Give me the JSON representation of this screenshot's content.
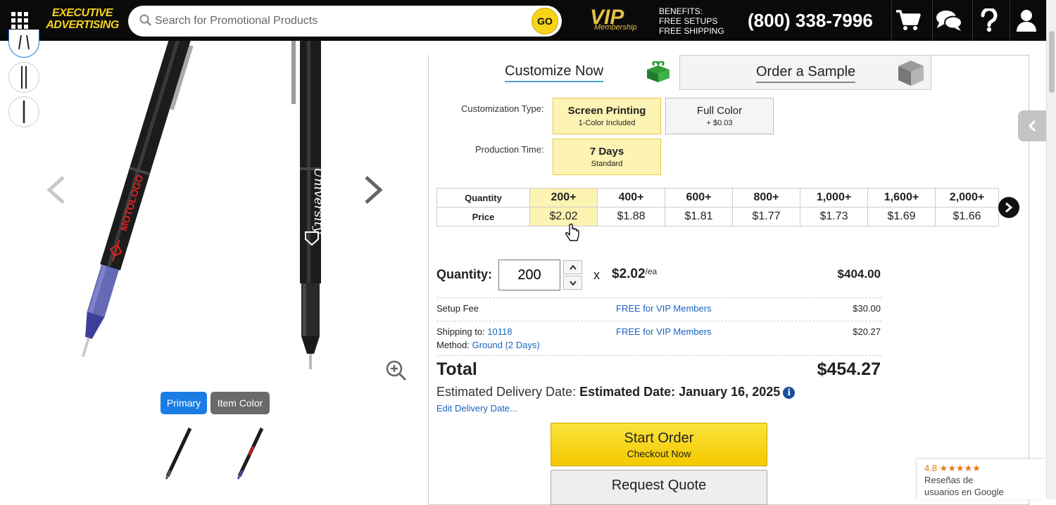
{
  "header": {
    "logo_line1": "EXECUTIVE",
    "logo_line2": "ADVERTISING",
    "search_placeholder": "Search for Promotional Products",
    "go_label": "GO",
    "vip_label": "VIP",
    "vip_sub": "Membership",
    "benefits": [
      "BENEFITS:",
      "FREE SETUPS",
      "FREE SHIPPING"
    ],
    "phone": "(800) 338-7996",
    "icons": [
      "apps-grid-icon",
      "cart-icon",
      "chat-icon",
      "help-icon",
      "user-icon"
    ]
  },
  "gallery": {
    "pen1_logo": "MOTOLOGO",
    "pen2_logo": "University",
    "primary_label": "Primary",
    "item_color_label": "Item Color"
  },
  "tabs": {
    "customize": "Customize Now",
    "sample": "Order a Sample"
  },
  "customization": {
    "type_label": "Customization Type:",
    "production_label": "Production Time:",
    "screen_printing": {
      "title": "Screen Printing",
      "sub": "1-Color Included"
    },
    "full_color": {
      "title": "Full Color",
      "sub": "+ $0.03"
    },
    "seven_days": {
      "title": "7 Days",
      "sub": "Standard"
    }
  },
  "price_table": {
    "quantity_label": "Quantity",
    "price_label": "Price",
    "quantities": [
      "200+",
      "400+",
      "600+",
      "800+",
      "1,000+",
      "1,600+",
      "2,000+"
    ],
    "prices": [
      "$2.02",
      "$1.88",
      "$1.81",
      "$1.77",
      "$1.73",
      "$1.69",
      "$1.66"
    ]
  },
  "order": {
    "quantity_label": "Quantity:",
    "quantity_value": "200",
    "x": "x",
    "unit_price": "$2.02",
    "unit_suffix": "/ea",
    "line_total": "$404.00",
    "setup_label": "Setup Fee",
    "setup_vip": "FREE for VIP Members",
    "setup_price": "$30.00",
    "shipping_label": "Shipping to:",
    "shipping_zip": "10118",
    "shipping_vip": "FREE for VIP Members",
    "shipping_price": "$20.27",
    "method_label": "Method:",
    "method_value": "Ground (2 Days)",
    "total_label": "Total",
    "total_value": "$454.27",
    "est_label": "Estimated Delivery Date:",
    "est_value": "Estimated Date: January 16, 2025",
    "edit_delivery": "Edit Delivery Date...",
    "start_order": "Start Order",
    "checkout_now": "Checkout Now",
    "request_quote": "Request Quote"
  },
  "google": {
    "rating": "4.8 ★★★★★",
    "line1": "Reseñas de",
    "line2": "usuarios en Google"
  },
  "colors": {
    "accent_yellow": "#f7d417",
    "selected_bg": "#fdf3b3",
    "link_blue": "#1a64c0",
    "primary_btn": "#1a7de4"
  }
}
